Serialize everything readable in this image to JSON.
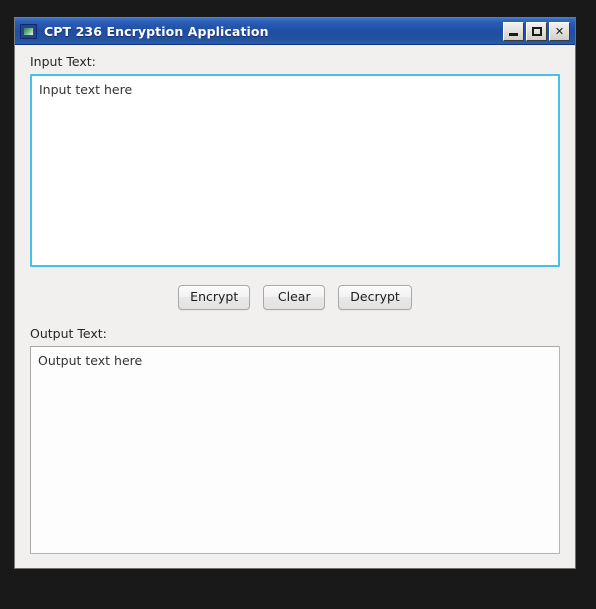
{
  "window": {
    "title": "CPT 236 Encryption Application",
    "icon": "monitor-icon",
    "controls": {
      "minimize": "_",
      "maximize": "□",
      "close": "✕"
    },
    "colors": {
      "titlebar_blue": "#1f4da6",
      "focus_border": "#45c0e8",
      "body_background": "#f1f0ef",
      "desktop_background": "#191919"
    }
  },
  "input_section": {
    "label": "Input Text:",
    "value": "Input text here",
    "placeholder": "Input text here"
  },
  "buttons": [
    {
      "id": "encrypt",
      "label": "Encrypt"
    },
    {
      "id": "clear",
      "label": "Clear"
    },
    {
      "id": "decrypt",
      "label": "Decrypt"
    }
  ],
  "output_section": {
    "label": "Output Text:",
    "value": "Output text here",
    "placeholder": "Output text here"
  }
}
